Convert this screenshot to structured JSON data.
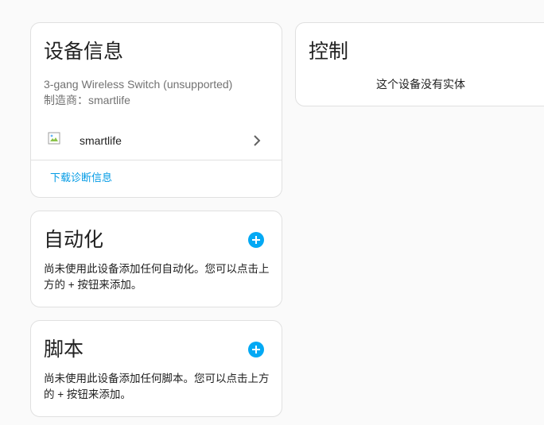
{
  "device_info": {
    "title": "设备信息",
    "model": "3-gang Wireless Switch (unsupported)",
    "manufacturer": "制造商：smartlife",
    "integration": "smartlife",
    "download_diagnostics": "下载诊断信息"
  },
  "automations": {
    "title": "自动化",
    "empty_text": "尚未使用此设备添加任何自动化。您可以点击上方的 + 按钮来添加。"
  },
  "scripts": {
    "title": "脚本",
    "empty_text": "尚未使用此设备添加任何脚本。您可以点击上方的 + 按钮来添加。"
  },
  "controls": {
    "title": "控制",
    "empty_text": "这个设备没有实体"
  },
  "colors": {
    "accent": "#03a9f4",
    "link": "#039be5"
  },
  "icons": [
    "broken-image-icon",
    "chevron-right-icon",
    "add-icon"
  ]
}
